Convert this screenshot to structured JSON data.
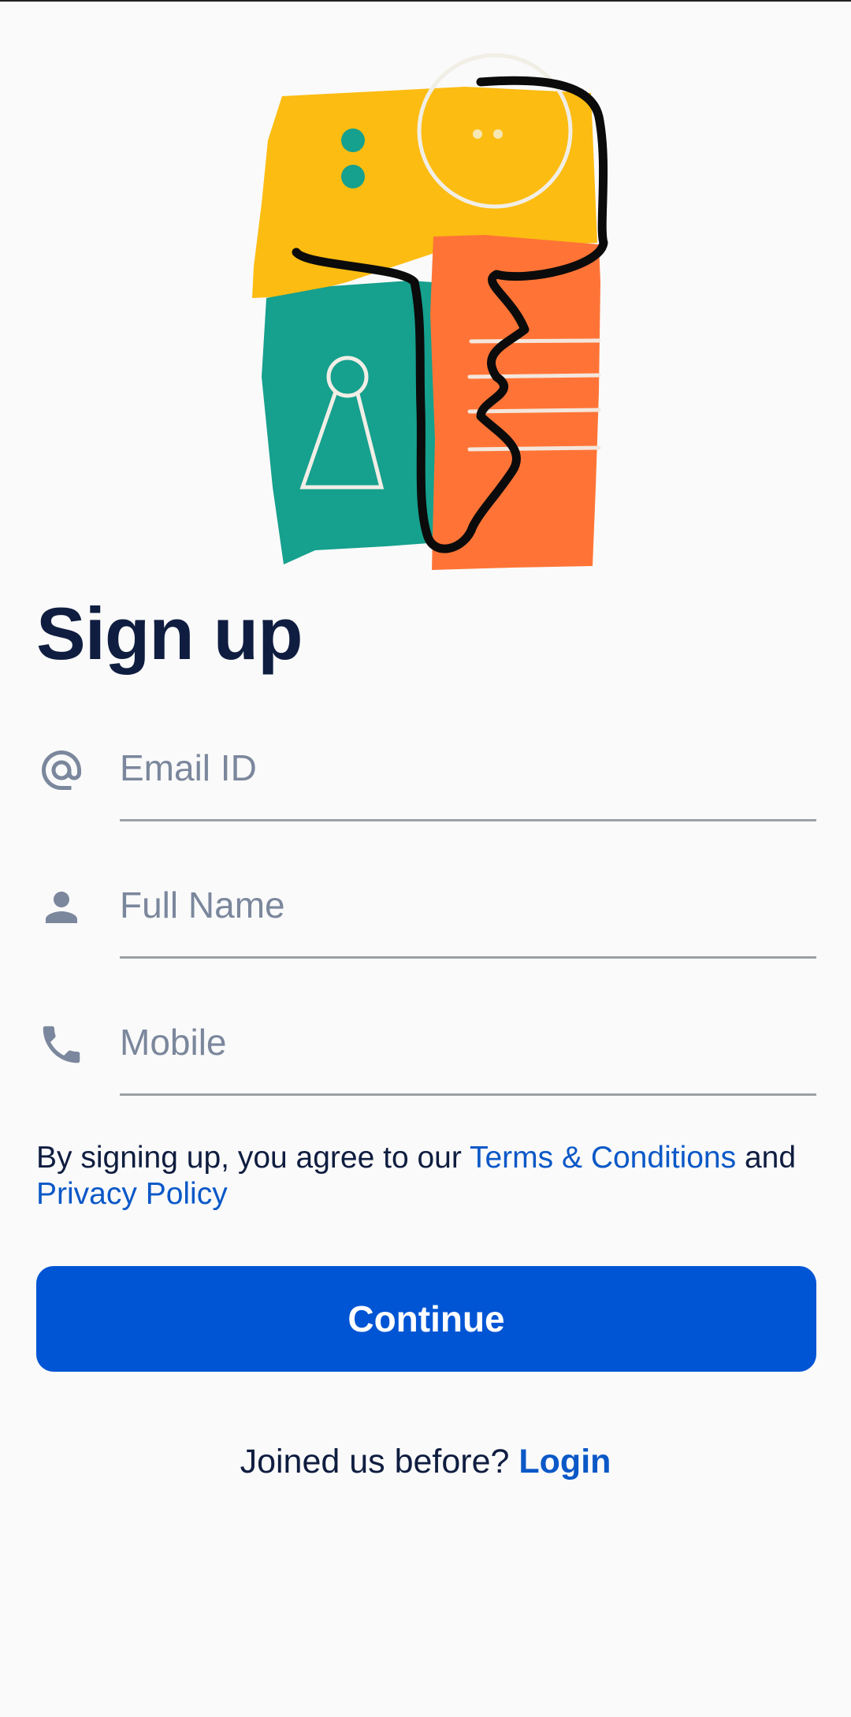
{
  "page": {
    "title": "Sign up"
  },
  "form": {
    "email": {
      "placeholder": "Email ID",
      "value": "",
      "icon": "at-icon"
    },
    "full_name": {
      "placeholder": "Full Name",
      "value": "",
      "icon": "person-icon"
    },
    "mobile": {
      "placeholder": "Mobile",
      "value": "",
      "icon": "phone-icon"
    }
  },
  "terms": {
    "prefix": "By signing up, you agree to our ",
    "terms_link": "Terms & Conditions",
    "middle": " and",
    "privacy_link": "Privacy Policy"
  },
  "actions": {
    "continue_label": "Continue"
  },
  "footer": {
    "prompt": "Joined us before? ",
    "login_label": "Login"
  },
  "colors": {
    "background": "#fafafa",
    "title": "#0f1d40",
    "placeholder": "#7b879c",
    "link": "#0b58c7",
    "primary_button": "#0055d4",
    "illustration_yellow": "#fcbc12",
    "illustration_teal": "#16a08e",
    "illustration_orange": "#ff7436"
  }
}
